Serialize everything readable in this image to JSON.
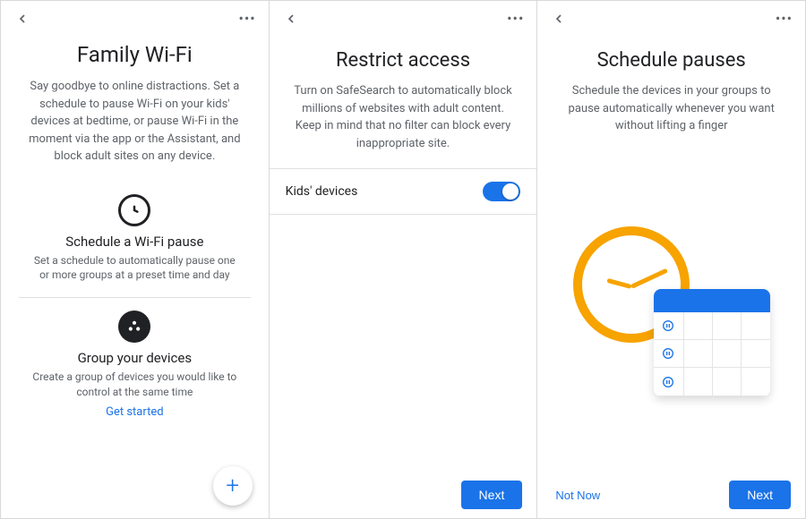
{
  "panel1": {
    "title": "Family Wi-Fi",
    "subtitle": "Say goodbye to online distractions. Set a schedule to pause Wi-Fi on your kids' devices at bedtime, or pause Wi-Fi in the moment via the app or the Assistant, and block adult sites on any device.",
    "section1": {
      "title": "Schedule a Wi-Fi pause",
      "desc": "Set a schedule to automatically pause one or more groups at a preset time and day"
    },
    "section2": {
      "title": "Group your devices",
      "desc": "Create a group of devices you would like to control at the same time",
      "link": "Get started"
    }
  },
  "panel2": {
    "title": "Restrict access",
    "subtitle": "Turn on SafeSearch to automatically block millions of websites with adult content. Keep in mind that no filter can block every inappropriate site.",
    "row_label": "Kids' devices",
    "toggle_on": true,
    "next": "Next"
  },
  "panel3": {
    "title": "Schedule pauses",
    "subtitle": "Schedule the devices in your groups to pause automatically whenever you want without lifting a finger",
    "not_now": "Not Now",
    "next": "Next"
  }
}
